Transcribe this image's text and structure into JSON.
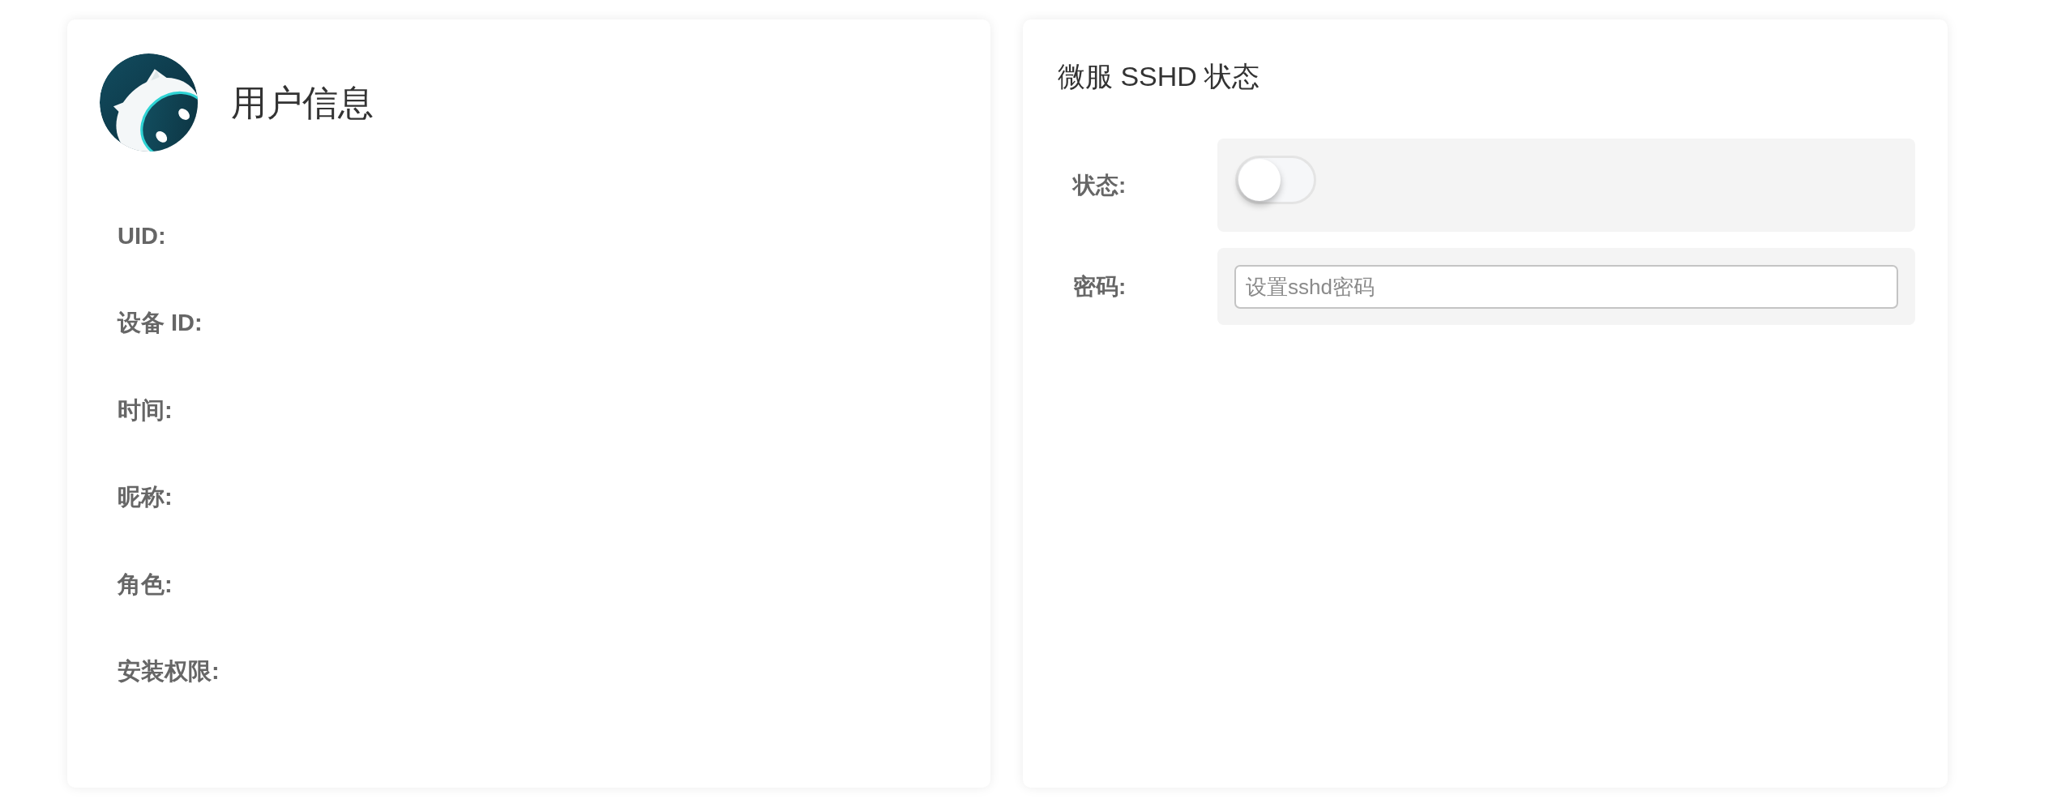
{
  "user_info": {
    "title": "用户信息",
    "fields": [
      {
        "label": "UID:"
      },
      {
        "label": "设备 ID:"
      },
      {
        "label": "时间:"
      },
      {
        "label": "昵称:"
      },
      {
        "label": "角色:"
      },
      {
        "label": "安装权限:"
      }
    ]
  },
  "sshd": {
    "title": "微服 SSHD 状态",
    "rows": [
      {
        "kind": "switch",
        "label": "状态:",
        "on": false
      },
      {
        "kind": "input",
        "label": "密码:",
        "placeholder": "设置sshd密码"
      }
    ]
  }
}
